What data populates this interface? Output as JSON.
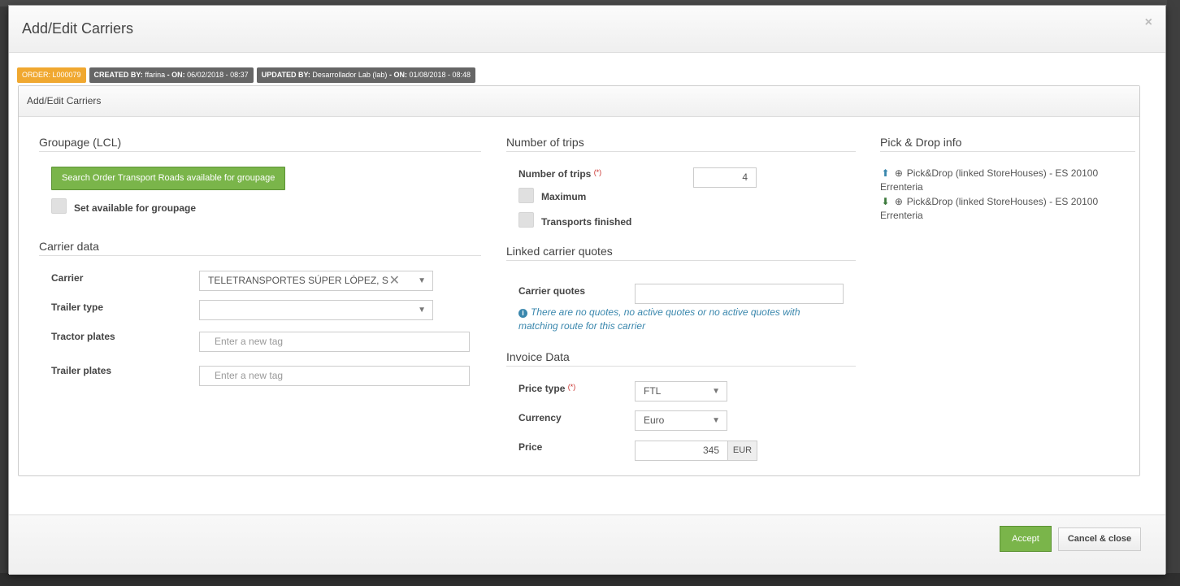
{
  "modal": {
    "title": "Add/Edit Carriers",
    "close_icon": "close-icon"
  },
  "badges": {
    "order": "ORDER: L000079",
    "created_label": "CREATED BY:",
    "created_user": "ffarina",
    "created_on_label": "- ON:",
    "created_on": "06/02/2018 - 08:37",
    "updated_label": "UPDATED BY:",
    "updated_user": "Desarrollador Lab (lab)",
    "updated_on_label": "- ON:",
    "updated_on": "01/08/2018 - 08:48",
    "colors": {
      "order": "#f0a830",
      "meta": "#666666"
    }
  },
  "panel": {
    "heading": "Add/Edit Carriers"
  },
  "groupage": {
    "title": "Groupage (LCL)",
    "search_button": "Search Order Transport Roads available for groupage",
    "available_label": "Set available for groupage",
    "available_checked": false
  },
  "carrier_data": {
    "title": "Carrier data",
    "carrier_label": "Carrier",
    "carrier_value": "TELETRANSPORTES SÚPER LÓPEZ, S",
    "trailer_type_label": "Trailer type",
    "trailer_type_value": "",
    "tractor_plates_label": "Tractor plates",
    "tractor_plates_placeholder": "Enter a new tag",
    "trailer_plates_label": "Trailer plates",
    "trailer_plates_placeholder": "Enter a new tag"
  },
  "trips": {
    "title": "Number of trips",
    "number_label": "Number of trips",
    "required_mark": "(*)",
    "number_value": "4",
    "maximum_label": "Maximum",
    "maximum_checked": false,
    "finished_label": "Transports finished",
    "finished_checked": false
  },
  "quotes": {
    "title": "Linked carrier quotes",
    "label": "Carrier quotes",
    "value": "",
    "note": "There are no quotes, no active quotes or no active quotes with matching route for this carrier"
  },
  "invoice": {
    "title": "Invoice Data",
    "price_type_label": "Price type",
    "required_mark": "(*)",
    "price_type_value": "FTL",
    "currency_label": "Currency",
    "currency_value": "Euro",
    "price_label": "Price",
    "price_value": "345",
    "price_unit": "EUR"
  },
  "pick_drop": {
    "title": "Pick & Drop info",
    "entries": [
      {
        "icon": "upload-icon",
        "text": "Pick&Drop (linked StoreHouses) - ES 20100 Errenteria"
      },
      {
        "icon": "download-icon",
        "text": "Pick&Drop (linked StoreHouses) - ES 20100 Errenteria"
      }
    ]
  },
  "footer": {
    "accept_label": "Accept",
    "cancel_label": "Cancel & close"
  }
}
